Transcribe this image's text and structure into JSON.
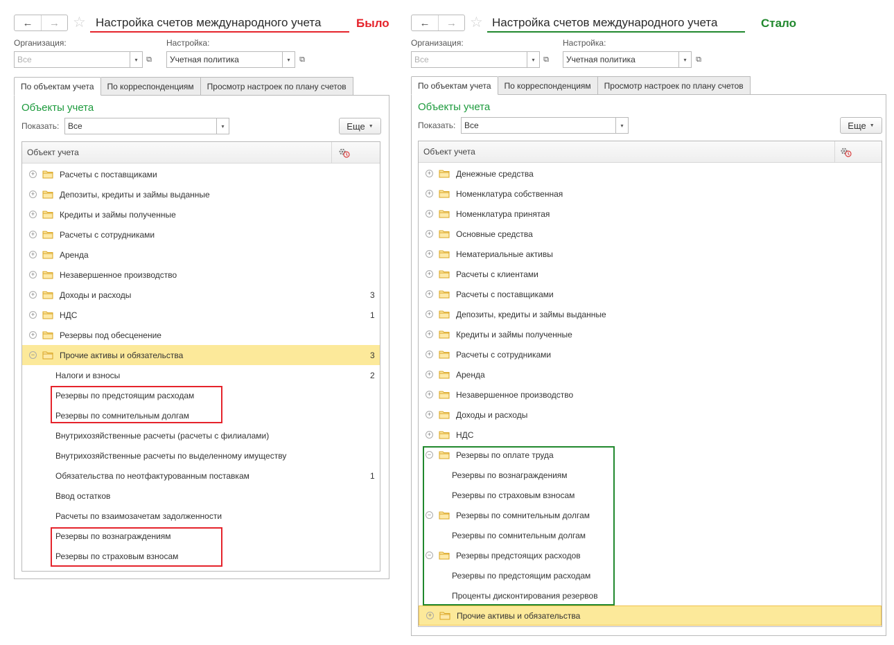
{
  "left": {
    "nav": {
      "back": "←",
      "forward": "→"
    },
    "title": "Настройка счетов международного учета",
    "caption": "Было",
    "organization": {
      "label": "Организация:",
      "placeholder": "Все"
    },
    "setting": {
      "label": "Настройка:",
      "value": "Учетная политика"
    },
    "tabs": [
      "По объектам учета",
      "По корреспонденциям",
      "Просмотр настроек по плану счетов"
    ],
    "section_title": "Объекты учета",
    "show": {
      "label": "Показать:",
      "value": "Все"
    },
    "more": "Еще",
    "table": {
      "column": "Объект учета",
      "rows": [
        {
          "label": "Расчеты с поставщиками",
          "count": ""
        },
        {
          "label": "Депозиты, кредиты и займы выданные",
          "count": ""
        },
        {
          "label": "Кредиты и займы полученные",
          "count": ""
        },
        {
          "label": "Расчеты с сотрудниками",
          "count": ""
        },
        {
          "label": "Аренда",
          "count": ""
        },
        {
          "label": "Незавершенное производство",
          "count": ""
        },
        {
          "label": "Доходы и расходы",
          "count": "3"
        },
        {
          "label": "НДС",
          "count": "1"
        },
        {
          "label": "Резервы под обесценение",
          "count": ""
        },
        {
          "label": "Прочие активы и обязательства",
          "count": "3"
        },
        {
          "label": "Налоги и взносы",
          "count": "2"
        },
        {
          "label": "Резервы по предстоящим расходам",
          "count": ""
        },
        {
          "label": "Резервы по сомнительным долгам",
          "count": ""
        },
        {
          "label": "Внутрихозяйственные расчеты (расчеты с филиалами)",
          "count": ""
        },
        {
          "label": "Внутрихозяйственные расчеты по выделенному имуществу",
          "count": ""
        },
        {
          "label": "Обязательства по неотфактурованным поставкам",
          "count": "1"
        },
        {
          "label": "Ввод остатков",
          "count": ""
        },
        {
          "label": "Расчеты по взаимозачетам задолженности",
          "count": ""
        },
        {
          "label": "Резервы по вознаграждениям",
          "count": ""
        },
        {
          "label": "Резервы по страховым взносам",
          "count": ""
        }
      ]
    }
  },
  "right": {
    "nav": {
      "back": "←",
      "forward": "→"
    },
    "title": "Настройка счетов международного учета",
    "caption": "Стало",
    "organization": {
      "label": "Организация:",
      "placeholder": "Все"
    },
    "setting": {
      "label": "Настройка:",
      "value": "Учетная политика"
    },
    "tabs": [
      "По объектам учета",
      "По корреспонденциям",
      "Просмотр настроек по плану счетов"
    ],
    "section_title": "Объекты учета",
    "show": {
      "label": "Показать:",
      "value": "Все"
    },
    "more": "Еще",
    "table": {
      "column": "Объект учета",
      "rows": [
        {
          "label": "Денежные средства"
        },
        {
          "label": "Номенклатура собственная"
        },
        {
          "label": "Номенклатура принятая"
        },
        {
          "label": "Основные средства"
        },
        {
          "label": "Нематериальные активы"
        },
        {
          "label": "Расчеты с клиентами"
        },
        {
          "label": "Расчеты с поставщиками"
        },
        {
          "label": "Депозиты, кредиты и займы выданные"
        },
        {
          "label": "Кредиты и займы полученные"
        },
        {
          "label": "Расчеты с сотрудниками"
        },
        {
          "label": "Аренда"
        },
        {
          "label": "Незавершенное производство"
        },
        {
          "label": "Доходы и расходы"
        },
        {
          "label": "НДС"
        },
        {
          "label": "Резервы по оплате труда"
        },
        {
          "label": "Резервы по вознаграждениям"
        },
        {
          "label": "Резервы по страховым взносам"
        },
        {
          "label": "Резервы по сомнительным долгам"
        },
        {
          "label": "Резервы по сомнительным долгам"
        },
        {
          "label": "Резервы предстоящих расходов"
        },
        {
          "label": "Резервы по предстоящим расходам"
        },
        {
          "label": "Проценты дисконтирования резервов"
        },
        {
          "label": "Прочие активы и обязательства"
        }
      ]
    }
  },
  "colors": {
    "accent_green": "#1c9a3c",
    "before_red": "#e5232b",
    "after_green": "#20882d",
    "highlight": "#fce99a"
  }
}
